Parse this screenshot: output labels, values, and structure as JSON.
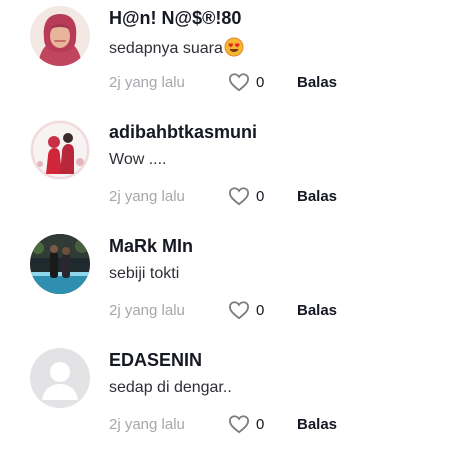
{
  "comments": [
    {
      "username": "H@n! N@$®!80",
      "text": "sedapnya suara",
      "emoji": "smiling-face-with-heart-eyes",
      "time": "2j yang lalu",
      "likes": "0",
      "reply_label": "Balas",
      "avatar": "woman-hijab-photo"
    },
    {
      "username": "adibahbtkasmuni",
      "text": "Wow ....",
      "time": "2j yang lalu",
      "likes": "0",
      "reply_label": "Balas",
      "avatar": "couple-photo"
    },
    {
      "username": "MaRk MIn",
      "text": "sebiji tokti",
      "time": "2j yang lalu",
      "likes": "0",
      "reply_label": "Balas",
      "avatar": "night-pool-photo"
    },
    {
      "username": "EDASENIN",
      "text": "sedap di dengar..",
      "time": "2j yang lalu",
      "likes": "0",
      "reply_label": "Balas",
      "avatar": "default-avatar"
    }
  ],
  "icons": {
    "like": "heart-outline-icon"
  },
  "colors": {
    "username": "#161823",
    "meta": "#a6a7ab",
    "icon": "#7b7c82"
  }
}
